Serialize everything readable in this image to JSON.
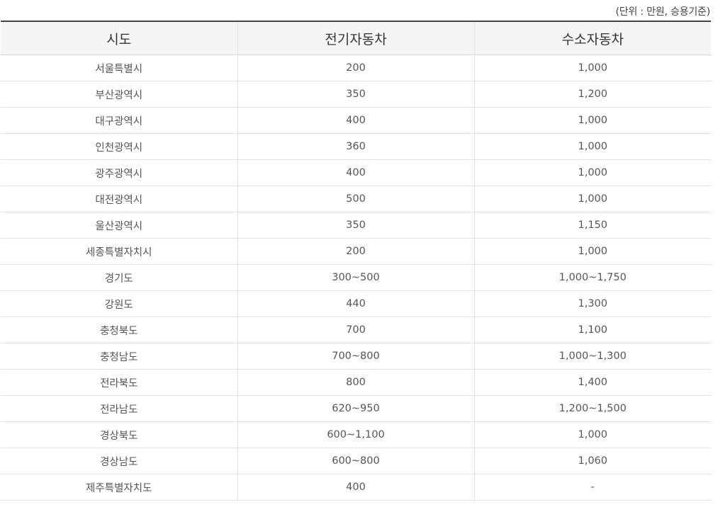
{
  "unit_note": "(단위 : 만원, 승용기준)",
  "table": {
    "headers": [
      "시도",
      "전기자동차",
      "수소자동차"
    ],
    "rows": [
      [
        "서울특별시",
        "200",
        "1,000"
      ],
      [
        "부산광역시",
        "350",
        "1,200"
      ],
      [
        "대구광역시",
        "400",
        "1,000"
      ],
      [
        "인천광역시",
        "360",
        "1,000"
      ],
      [
        "광주광역시",
        "400",
        "1,000"
      ],
      [
        "대전광역시",
        "500",
        "1,000"
      ],
      [
        "울산광역시",
        "350",
        "1,150"
      ],
      [
        "세종특별자치시",
        "200",
        "1,000"
      ],
      [
        "경기도",
        "300~500",
        "1,000~1,750"
      ],
      [
        "강원도",
        "440",
        "1,300"
      ],
      [
        "충청북도",
        "700",
        "1,100"
      ],
      [
        "충청남도",
        "700~800",
        "1,000~1,300"
      ],
      [
        "전라북도",
        "800",
        "1,400"
      ],
      [
        "전라남도",
        "620~950",
        "1,200~1,500"
      ],
      [
        "경상북도",
        "600~1,100",
        "1,000"
      ],
      [
        "경상남도",
        "600~800",
        "1,060"
      ],
      [
        "제주특별자치도",
        "400",
        "-"
      ]
    ]
  }
}
